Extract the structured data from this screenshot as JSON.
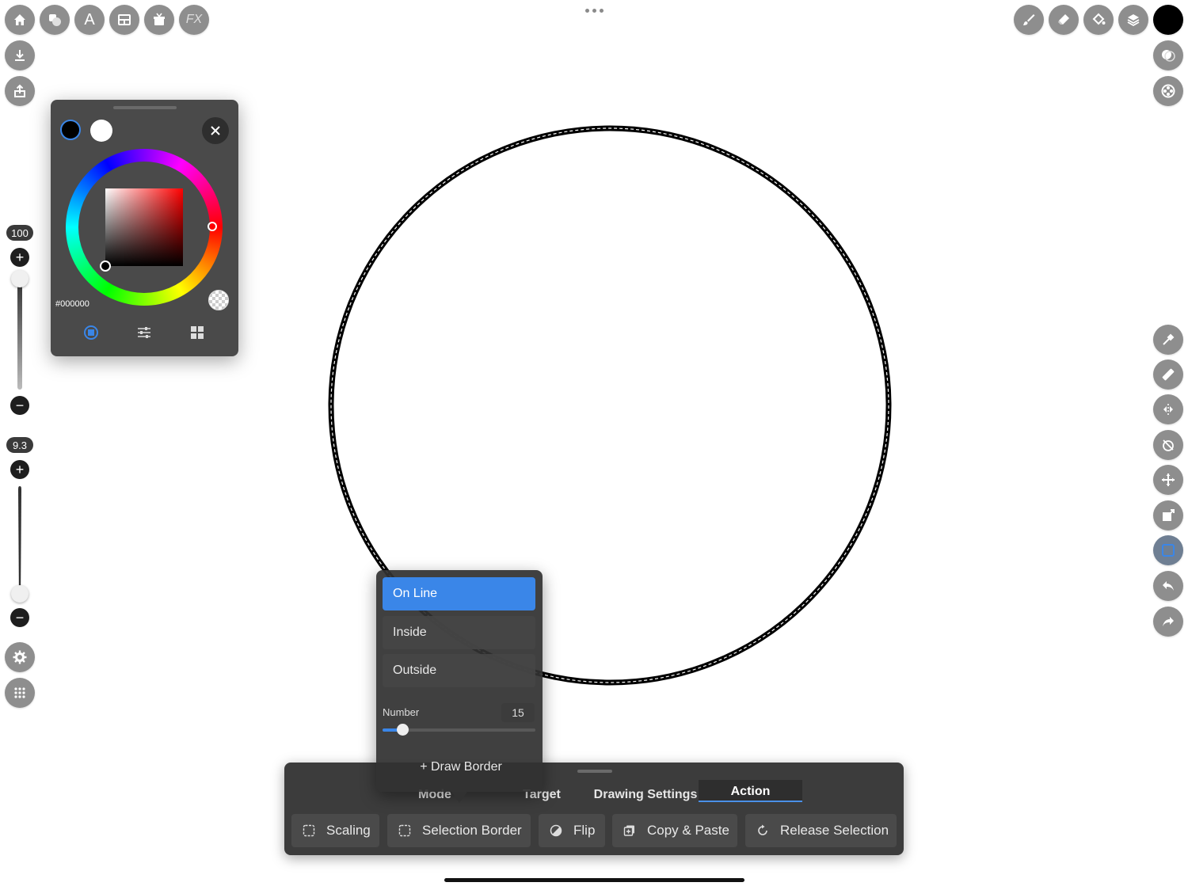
{
  "top_left_toolbar": [
    {
      "name": "home-icon"
    },
    {
      "name": "shapes-icon"
    },
    {
      "name": "text-icon",
      "label": "A"
    },
    {
      "name": "layout-icon"
    },
    {
      "name": "materials-icon"
    },
    {
      "name": "fx-icon",
      "label": "FX"
    }
  ],
  "top_right_toolbar": [
    {
      "name": "brush-icon"
    },
    {
      "name": "eraser-icon"
    },
    {
      "name": "fill-bucket-icon"
    },
    {
      "name": "layers-icon"
    }
  ],
  "current_color": "#000000",
  "left_sliders": {
    "opacity_value": "100",
    "opacity_level": 1.0,
    "size_value": "9.3",
    "size_level": 0.08
  },
  "color_panel": {
    "primary": "#000000",
    "secondary": "#ffffff",
    "hex": "#000000",
    "tabs": [
      "wheel-icon",
      "sliders-icon",
      "palette-grid-icon"
    ]
  },
  "border_popup": {
    "options": [
      "On Line",
      "Inside",
      "Outside"
    ],
    "selected": "On Line",
    "number_label": "Number",
    "number_value": "15",
    "number_level": 0.13,
    "draw_label": "+ Draw Border"
  },
  "bottom_toolbar": {
    "tabs": [
      "Mode",
      "Target",
      "Drawing Settings",
      "Action"
    ],
    "active_tab": "Action",
    "actions": [
      "Scaling",
      "Selection Border",
      "Flip",
      "Copy & Paste",
      "Release Selection"
    ]
  },
  "accent_color": "#3a86e8"
}
